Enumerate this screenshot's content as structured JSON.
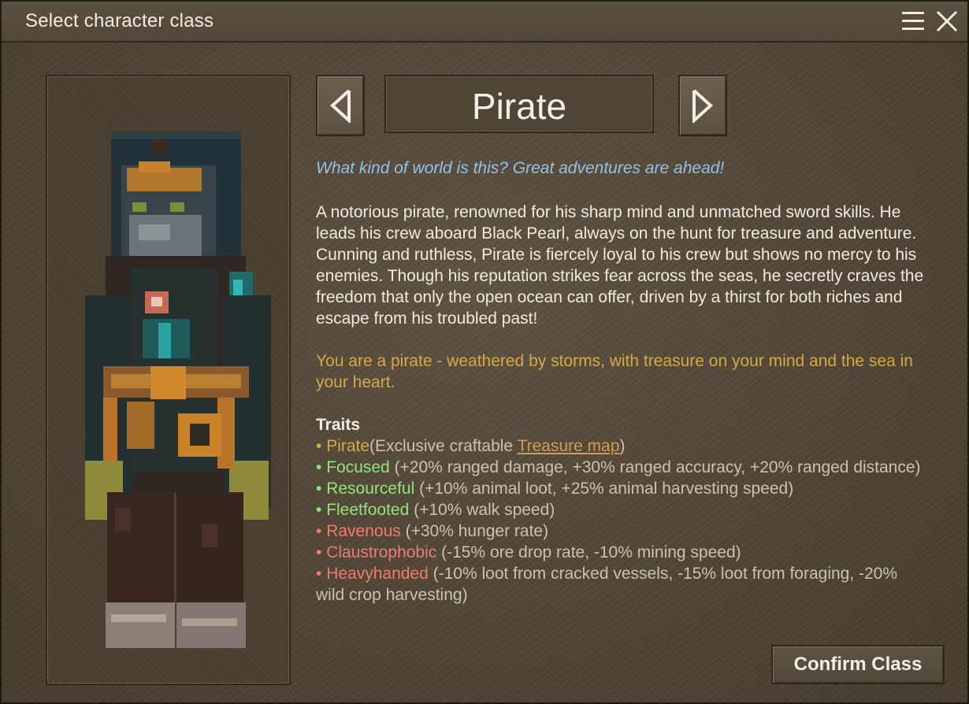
{
  "window": {
    "title": "Select character class",
    "menu_icon": "hamburger-menu-icon",
    "close_icon": "close-icon"
  },
  "class_selector": {
    "prev_icon": "chevron-left-icon",
    "next_icon": "chevron-right-icon",
    "class_name": "Pirate"
  },
  "description": {
    "tagline": "What kind of world is this? Great adventures are ahead!",
    "body": "A notorious pirate, renowned for his sharp mind and unmatched sword skills. He leads his crew aboard Black Pearl, always on the hunt for treasure and adventure. Cunning and ruthless, Pirate is fiercely loyal to his crew but shows no mercy to his enemies. Though his reputation strikes fear across the seas, he secretly craves the freedom that only the open ocean can offer, driven by a thirst for both riches and escape from his troubled past!",
    "flavor": "You are a pirate -  weathered by storms, with treasure on your mind and the sea in your heart."
  },
  "traits": {
    "heading": "Traits",
    "items": [
      {
        "name": "Pirate",
        "details": "(Exclusive craftable ",
        "link": "Treasure map",
        "tail": ")",
        "kind": "special"
      },
      {
        "name": "Focused",
        "details": " (+20% ranged damage, +30% ranged accuracy, +20% ranged distance)",
        "kind": "positive"
      },
      {
        "name": "Resourceful",
        "details": " (+10% animal loot, +25% animal harvesting speed)",
        "kind": "positive"
      },
      {
        "name": "Fleetfooted",
        "details": " (+10% walk speed)",
        "kind": "positive"
      },
      {
        "name": "Ravenous",
        "details": " (+30% hunger rate)",
        "kind": "negative"
      },
      {
        "name": "Claustrophobic",
        "details": " (-15% ore drop rate, -10% mining speed)",
        "kind": "negative"
      },
      {
        "name": "Heavyhanded",
        "details": " (-10% loot from cracked vessels, -15% loot from foraging, -20% wild crop harvesting)",
        "kind": "negative"
      }
    ],
    "bullet": "• "
  },
  "actions": {
    "confirm_label": "Confirm Class"
  },
  "colors": {
    "tagline": "#8fc3ec",
    "flavor": "#d4a94a",
    "positive": "#8fe57a",
    "negative": "#f07a72",
    "special": "#d4a94a"
  }
}
